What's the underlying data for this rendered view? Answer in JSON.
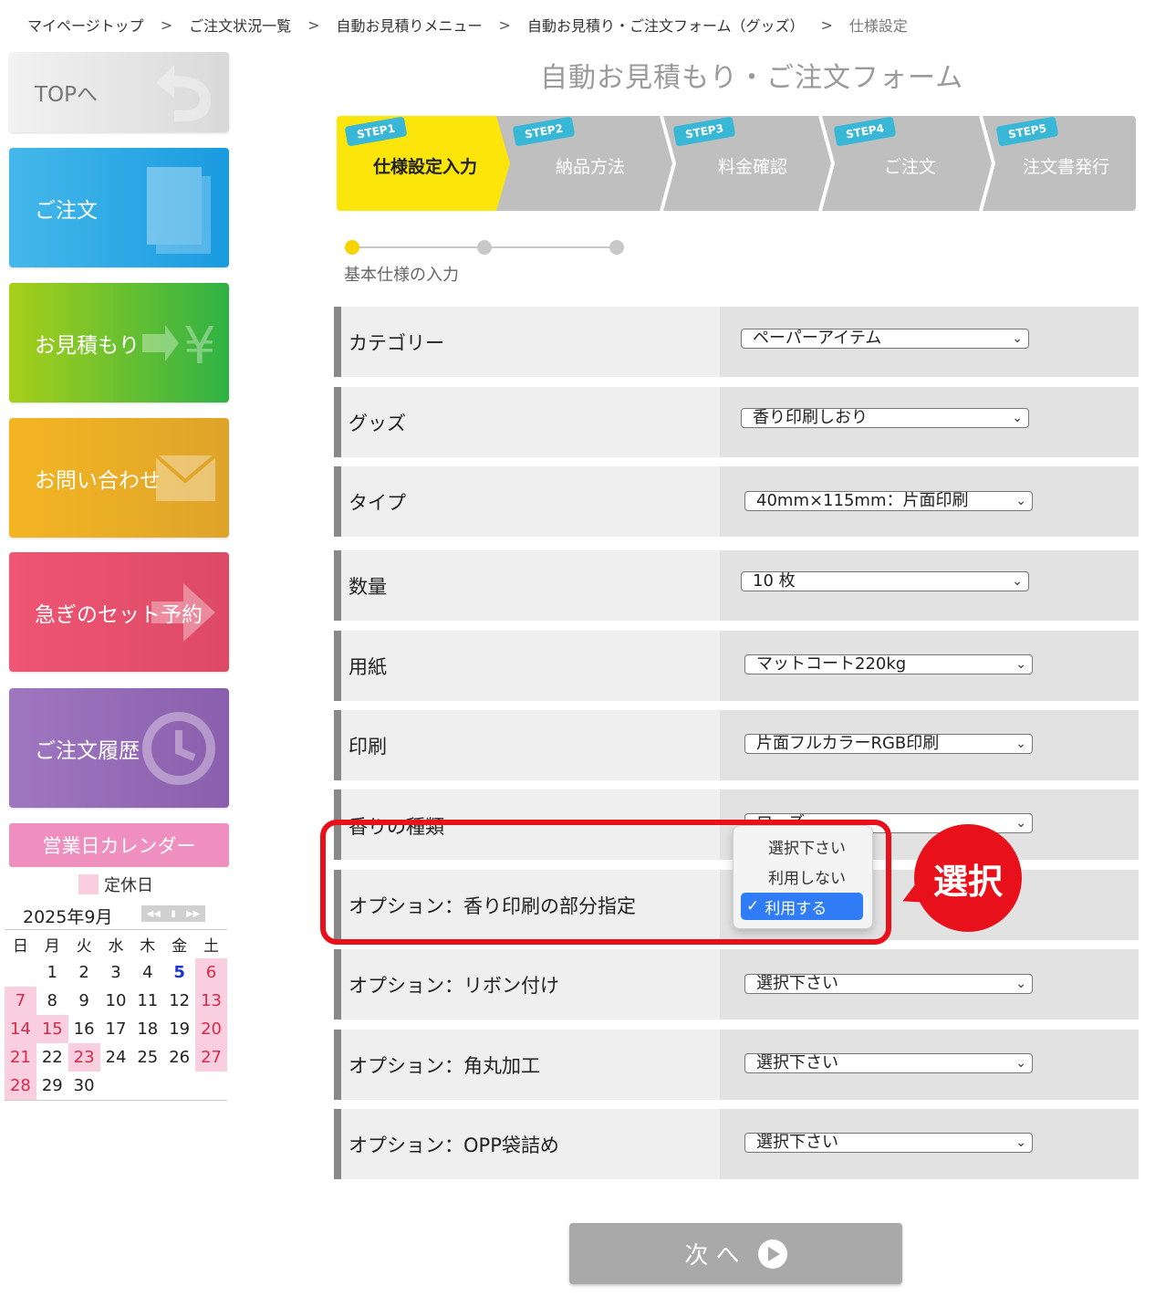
{
  "breadcrumb": {
    "items": [
      "マイページトップ",
      "ご注文状況一覧",
      "自動お見積りメニュー",
      "自動お見積り・ご注文フォーム（グッズ）",
      "仕様設定"
    ],
    "separator": ">"
  },
  "sidebar": {
    "top": "TOPへ",
    "order": "ご注文",
    "estimate": "お見積もり",
    "contact": "お問い合わせ",
    "rush": "急ぎのセット予約",
    "history": "ご注文履歴"
  },
  "calendar": {
    "header": "営業日カレンダー",
    "legend": "定休日",
    "month": "2025年9月",
    "dow": [
      "日",
      "月",
      "火",
      "水",
      "木",
      "金",
      "土"
    ],
    "weeks": [
      [
        "",
        "1",
        "2",
        "3",
        "4",
        "5",
        "6"
      ],
      [
        "7",
        "8",
        "9",
        "10",
        "11",
        "12",
        "13"
      ],
      [
        "14",
        "15",
        "16",
        "17",
        "18",
        "19",
        "20"
      ],
      [
        "21",
        "22",
        "23",
        "24",
        "25",
        "26",
        "27"
      ],
      [
        "28",
        "29",
        "30",
        "",
        "",
        "",
        ""
      ]
    ]
  },
  "main": {
    "title": "自動お見積もり・ご注文フォーム",
    "steps": [
      {
        "tag": "STEP1",
        "label": "仕様設定入力"
      },
      {
        "tag": "STEP2",
        "label": "納品方法"
      },
      {
        "tag": "STEP3",
        "label": "料金確認"
      },
      {
        "tag": "STEP4",
        "label": "ご注文"
      },
      {
        "tag": "STEP5",
        "label": "注文書発行"
      }
    ],
    "progress_label": "基本仕様の入力",
    "rows": [
      {
        "label": "カテゴリー",
        "value": "ペーパーアイテム"
      },
      {
        "label": "グッズ",
        "value": "香り印刷しおり"
      },
      {
        "label": "タイプ",
        "value": "40mm×115mm：片面印刷"
      },
      {
        "label": "数量",
        "value": "10 枚"
      },
      {
        "label": "用紙",
        "value": "マットコート220kg"
      },
      {
        "label": "印刷",
        "value": "片面フルカラーRGB印刷"
      },
      {
        "label": "香りの種類",
        "value": "ローズ"
      },
      {
        "label": "オプション：香り印刷の部分指定",
        "value": ""
      },
      {
        "label": "オプション：リボン付け",
        "value": "選択下さい"
      },
      {
        "label": "オプション：角丸加工",
        "value": "選択下さい"
      },
      {
        "label": "オプション：OPP袋詰め",
        "value": "選択下さい"
      }
    ],
    "dropdown_options": [
      "選択下さい",
      "利用しない",
      "利用する"
    ],
    "callout": "選択",
    "next_button": "次 へ"
  }
}
